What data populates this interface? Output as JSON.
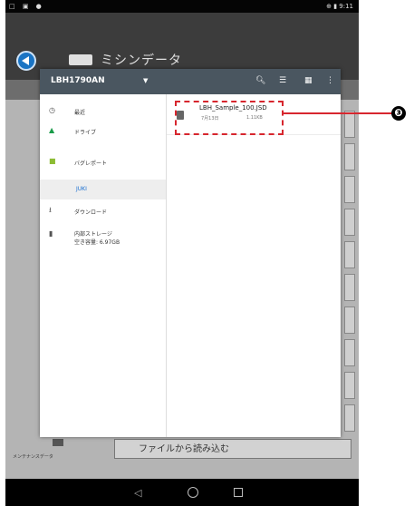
{
  "status_bar": {
    "left_icons": "□ ▣ ●",
    "right": "⊕ ▮ 9:11"
  },
  "app": {
    "title": "ミシンデータ"
  },
  "background": {
    "maintenance_label": "メンテナンスデータ",
    "read_button_label": "ファイルから読み込む"
  },
  "dialog": {
    "title": "LBH1790AN",
    "drawer": [
      {
        "label": "最近",
        "icon": "clock-icon"
      },
      {
        "label": "ドライブ",
        "icon": "drive-icon"
      },
      {
        "label": "バグレポート",
        "icon": "android-icon"
      },
      {
        "label": "JUKI",
        "icon": "",
        "selected": true
      },
      {
        "label": "ダウンロード",
        "icon": "download-icon"
      },
      {
        "label": "内部ストレージ",
        "sub": "空き容量: 6.97GB",
        "icon": "sd-card-icon"
      }
    ],
    "file": {
      "name": "LBH_Sample_100.JSD",
      "date": "7月13日",
      "size": "1.11KB"
    }
  },
  "callout": {
    "number": "❸"
  },
  "colors": {
    "accent": "#1a6fd0",
    "highlight": "#d7262e",
    "toolbar": "#4a5660"
  }
}
